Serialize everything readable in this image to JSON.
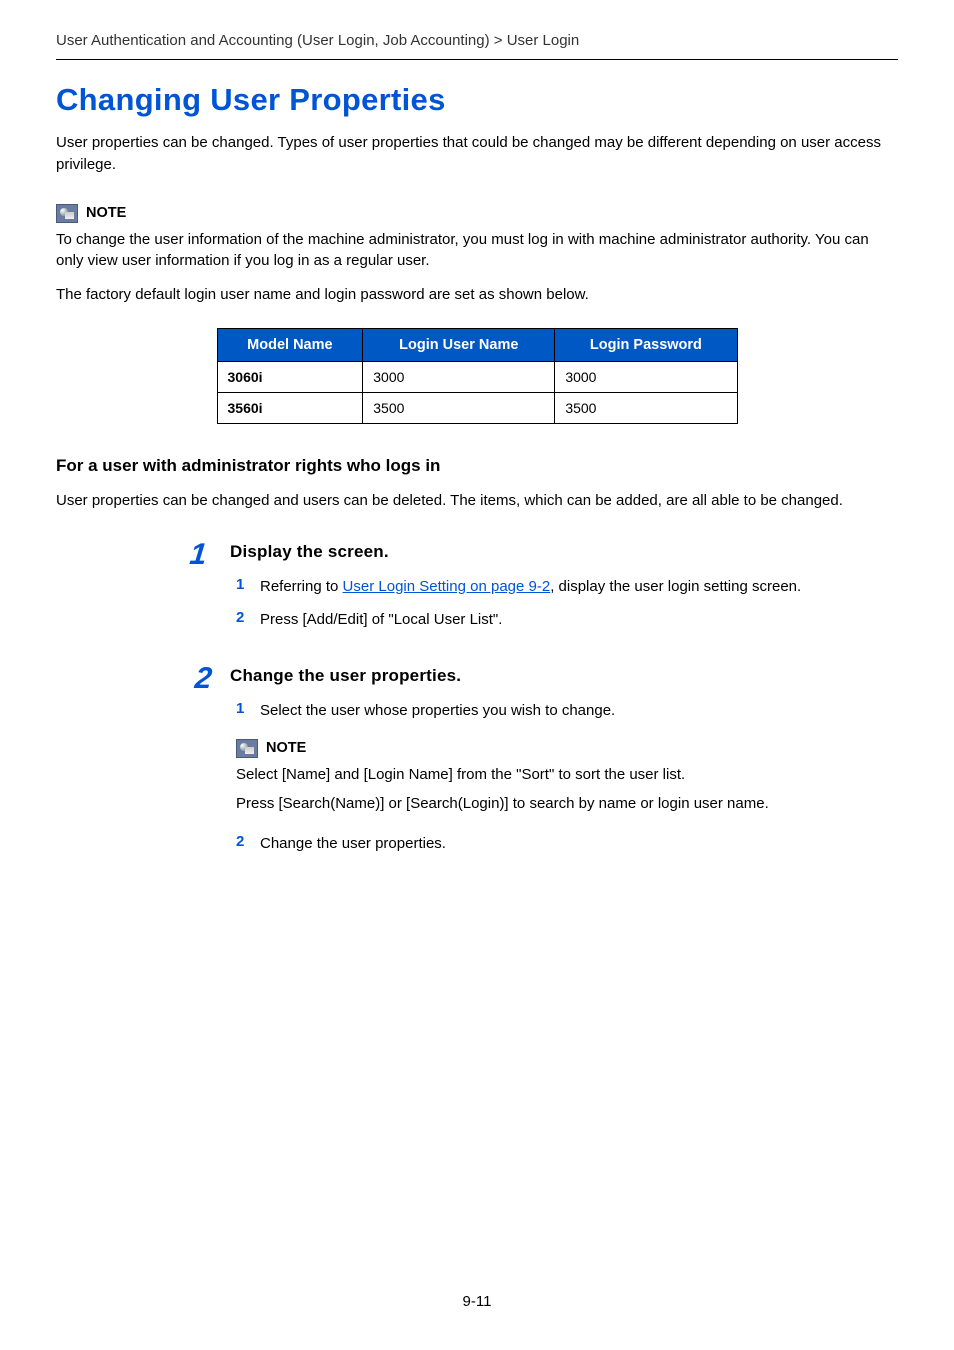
{
  "breadcrumb": "User Authentication and Accounting (User Login, Job Accounting) > User Login",
  "title": "Changing User Properties",
  "intro": "User properties can be changed. Types of user properties that could be changed may be different depending on user access privilege.",
  "note1": {
    "label": "NOTE",
    "line1": "To change the user information of the machine administrator, you must log in with machine administrator authority. You can only view user information if you log in as a regular user.",
    "line2": "The factory default login user name and login password are set as shown below."
  },
  "table": {
    "headers": {
      "c1": "Model Name",
      "c2": "Login User Name",
      "c3": "Login Password"
    },
    "rows": [
      {
        "model": "3060i",
        "user": "3000",
        "pass": "3000"
      },
      {
        "model": "3560i",
        "user": "3500",
        "pass": "3500"
      }
    ]
  },
  "section": {
    "heading": "For a user with administrator rights who logs in",
    "intro": "User properties can be changed and users can be deleted. The items, which can be added, are all able to be changed."
  },
  "steps": [
    {
      "num": "1",
      "title": "Display the screen.",
      "subs": [
        {
          "num": "1",
          "prefix": "Referring to ",
          "link": "User Login Setting on page 9-2",
          "suffix": ", display the user login setting screen."
        },
        {
          "num": "2",
          "text": "Press [Add/Edit] of \"Local User List\"."
        }
      ]
    },
    {
      "num": "2",
      "title": "Change the user properties.",
      "subs_a": [
        {
          "num": "1",
          "text": "Select the user whose properties you wish to change."
        }
      ],
      "inner_note": {
        "label": "NOTE",
        "line1": "Select [Name] and [Login Name] from the \"Sort\" to sort the user list.",
        "line2": "Press [Search(Name)] or [Search(Login)] to search by name or login user name."
      },
      "subs_b": [
        {
          "num": "2",
          "text": "Change the user properties."
        }
      ]
    }
  ],
  "page_number": "9-11"
}
